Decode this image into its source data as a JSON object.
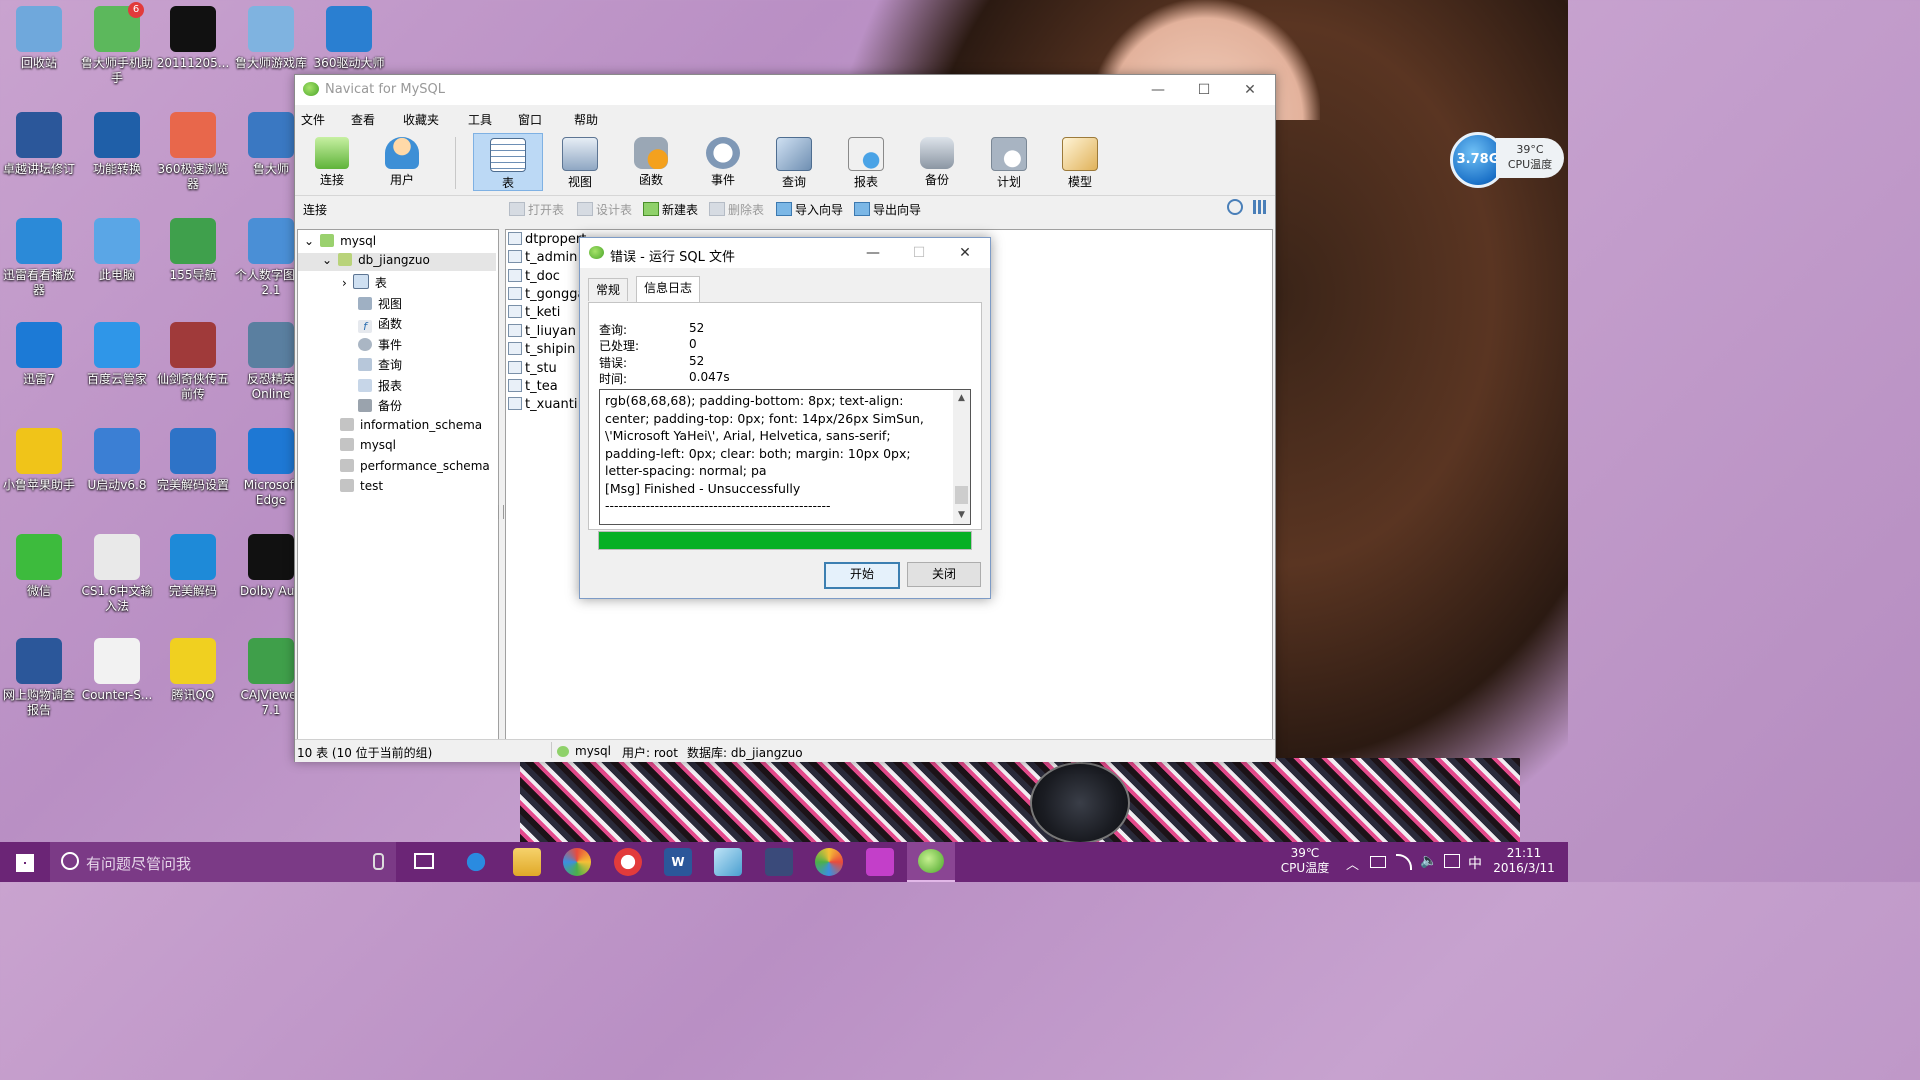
{
  "desktop": {
    "icons": [
      {
        "label": "回收站"
      },
      {
        "label": "鲁大师手机助手",
        "badge": "6"
      },
      {
        "label": "20111205..."
      },
      {
        "label": "鲁大师游戏库"
      },
      {
        "label": "360驱动大师"
      },
      {
        "label": "卓越讲坛修订"
      },
      {
        "label": "功能转换"
      },
      {
        "label": "360极速浏览器"
      },
      {
        "label": "鲁大师"
      },
      {
        "label": "迅雷看看播放器"
      },
      {
        "label": "此电脑"
      },
      {
        "label": "155导航"
      },
      {
        "label": "个人数字图馆2.1"
      },
      {
        "label": "迅雷7"
      },
      {
        "label": "百度云管家"
      },
      {
        "label": "仙剑奇侠传五前传"
      },
      {
        "label": "反恐精英Online"
      },
      {
        "label": "小鲁苹果助手"
      },
      {
        "label": "U启动v6.8"
      },
      {
        "label": "完美解码设置"
      },
      {
        "label": "Microsoft Edge"
      },
      {
        "label": "微信"
      },
      {
        "label": "CS1.6中文输入法"
      },
      {
        "label": "完美解码"
      },
      {
        "label": "Dolby Aud"
      },
      {
        "label": "网上购物调查报告"
      },
      {
        "label": "Counter-S..."
      },
      {
        "label": "腾讯QQ"
      },
      {
        "label": "CAJViewer 7.1"
      }
    ]
  },
  "widget": {
    "memory": "3.78G",
    "temp": "39°C",
    "temp_label": "CPU温度"
  },
  "window": {
    "title": "Navicat for MySQL",
    "menu": [
      "文件",
      "查看",
      "收藏夹",
      "工具",
      "窗口",
      "帮助"
    ],
    "toolbar": [
      "连接",
      "用户",
      "表",
      "视图",
      "函数",
      "事件",
      "查询",
      "报表",
      "备份",
      "计划",
      "模型"
    ],
    "connection_label": "连接",
    "actions": [
      "打开表",
      "设计表",
      "新建表",
      "删除表",
      "导入向导",
      "导出向导"
    ],
    "tree": [
      {
        "label": "mysql"
      },
      {
        "label": "db_jiangzuo"
      },
      {
        "label": "表"
      },
      {
        "label": "视图"
      },
      {
        "label": "函数"
      },
      {
        "label": "事件"
      },
      {
        "label": "查询"
      },
      {
        "label": "报表"
      },
      {
        "label": "备份"
      },
      {
        "label": "information_schema"
      },
      {
        "label": "mysql"
      },
      {
        "label": "performance_schema"
      },
      {
        "label": "test"
      }
    ],
    "tables": [
      "dtpropert",
      "t_admin",
      "t_doc",
      "t_gongga",
      "t_keti",
      "t_liuyan",
      "t_shipin",
      "t_stu",
      "t_tea",
      "t_xuanti"
    ],
    "status": {
      "count": "10 表 (10 位于当前的组)",
      "conn": "mysql",
      "user": "用户: root",
      "db": "数据库: db_jiangzuo"
    }
  },
  "dialog": {
    "title": "错误 - 运行 SQL 文件",
    "tabs": [
      "常规",
      "信息日志"
    ],
    "stats": [
      {
        "k": "查询:",
        "v": "52"
      },
      {
        "k": "已处理:",
        "v": "0"
      },
      {
        "k": "错误:",
        "v": "52"
      },
      {
        "k": "时间:",
        "v": "0.047s"
      }
    ],
    "log": "rgb(68,68,68); padding-bottom: 8px; text-align: center; padding-top: 0px; font: 14px/26px SimSun, \\'Microsoft YaHei\\', Arial, Helvetica, sans-serif; padding-left: 0px; clear: both; margin: 10px 0px; letter-spacing: normal; pa\n[Msg] Finished - Unsuccessfully\n--------------------------------------------------",
    "progress": 1.0,
    "start": "开始",
    "close": "关闭"
  },
  "taskbar": {
    "search": "有问题尽管问我",
    "temp": "39℃",
    "temp_label": "CPU温度",
    "ime": "中",
    "time": "21:11",
    "date": "2016/3/11"
  }
}
